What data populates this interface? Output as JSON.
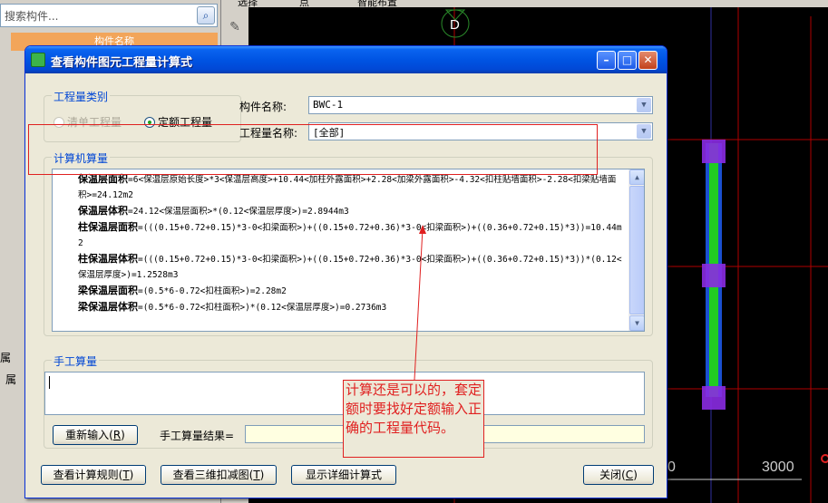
{
  "background": {
    "search_placeholder": "搜索构件...",
    "list_header": "构件名称",
    "side_label_a": "属",
    "side_label_b": "属",
    "toolbar_items": [
      "选择",
      "点",
      "智能布置"
    ],
    "axis_marker": "D",
    "dimension_left": "0",
    "dimension_value": "3000"
  },
  "dialog": {
    "title": "查看构件图元工程量计算式",
    "type_group": {
      "title": "工程量类别",
      "options": [
        {
          "label": "清单工程量",
          "selected": false,
          "enabled": false
        },
        {
          "label": "定额工程量",
          "selected": true,
          "enabled": true
        }
      ]
    },
    "component_name_label": "构件名称:",
    "component_name_value": "BWC-1",
    "quantity_name_label": "工程量名称:",
    "quantity_name_value": "[全部]",
    "calc_group_title": "计算机算量",
    "calc_lines": [
      {
        "name": "保温层面积",
        "formula": "=6<保温层原始长度>*3<保温层高度>+10.44<加柱外露面积>+2.28<加梁外露面积>-4.32<扣柱贴墙面积>-2.28<扣梁贴墙面积>=24.12m2"
      },
      {
        "name": "保温层体积",
        "formula": "=24.12<保温层面积>*(0.12<保温层厚度>)=2.8944m3"
      },
      {
        "name": "柱保温层面积",
        "formula": "=(((0.15+0.72+0.15)*3-0<扣梁面积>)+((0.15+0.72+0.36)*3-0<扣梁面积>)+((0.36+0.72+0.15)*3))=10.44m2"
      },
      {
        "name": "柱保温层体积",
        "formula": "=(((0.15+0.72+0.15)*3-0<扣梁面积>)+((0.15+0.72+0.36)*3-0<扣梁面积>)+((0.36+0.72+0.15)*3))*(0.12<保温层厚度>)=1.2528m3"
      },
      {
        "name": "梁保温层面积",
        "formula": "=(0.5*6-0.72<扣柱面积>)=2.28m2"
      },
      {
        "name": "梁保温层体积",
        "formula": "=(0.5*6-0.72<扣柱面积>)*(0.12<保温层厚度>)=0.2736m3"
      }
    ],
    "manual_group_title": "手工算量",
    "manual_input_value": "",
    "reinput_button": "重新输入(",
    "reinput_key": "R",
    "result_label": "手工算量结果=",
    "result_value": "",
    "buttons": {
      "rules": {
        "label": "查看计算规则(",
        "key": "T"
      },
      "view3d": {
        "label": "查看三维扣减图(",
        "key": "T"
      },
      "detail": {
        "label": "显示详细计算式"
      },
      "close": {
        "label": "关闭(",
        "key": "C"
      }
    }
  },
  "annotation": {
    "note": "计算还是可以的，套定额时要找好定额输入正确的工程量代码。"
  },
  "colors": {
    "highlight_red": "#e02020",
    "cad_green": "#22cc22",
    "cad_magenta": "#8a2be2",
    "cad_red_line": "#cc0000",
    "titlebar_blue": "#0054e3"
  }
}
